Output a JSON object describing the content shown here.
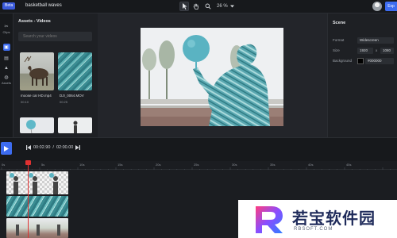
{
  "topbar": {
    "beta_label": "Beta",
    "project_name": "basketball waves",
    "zoom": "26 %",
    "export_label": "Exp"
  },
  "rail": {
    "items": [
      {
        "label": "Clips",
        "icon": "scissors-icon"
      },
      {
        "label": "",
        "icon": "media-icon"
      },
      {
        "label": "",
        "icon": "text-icon"
      },
      {
        "label": "",
        "icon": "elements-icon"
      },
      {
        "label": "Assets",
        "icon": "assets-icon"
      }
    ]
  },
  "assets": {
    "title": "Assets - Videos",
    "search_placeholder": "Search your videos",
    "items": [
      {
        "name": "moose car HD.mp4",
        "duration": "00:10"
      },
      {
        "name": "DJI_0064.MOV",
        "duration": "00:25"
      },
      {
        "name": "",
        "duration": ""
      },
      {
        "name": "",
        "duration": ""
      }
    ]
  },
  "scene": {
    "title": "Scene",
    "format_label": "Format",
    "format_value": "Widescreen",
    "size_label": "Size",
    "width": "1920",
    "height": "1080",
    "size_sep": "x",
    "bg_label": "Background",
    "bg_value": "#000000"
  },
  "transport": {
    "current": "00:02.90",
    "sep": "/",
    "total": "02:00.00"
  },
  "ruler": {
    "labels": [
      "0s",
      "5s",
      "10s",
      "15s",
      "20s",
      "25s",
      "30s",
      "35s",
      "40s",
      "45s"
    ]
  },
  "watermark": {
    "title": "若宝软件园",
    "url": "RBSOFT.COM"
  },
  "colors": {
    "accent": "#3d6cf0",
    "playhead": "#e03131",
    "panel": "#1e2024",
    "background": "#1b1d21"
  }
}
